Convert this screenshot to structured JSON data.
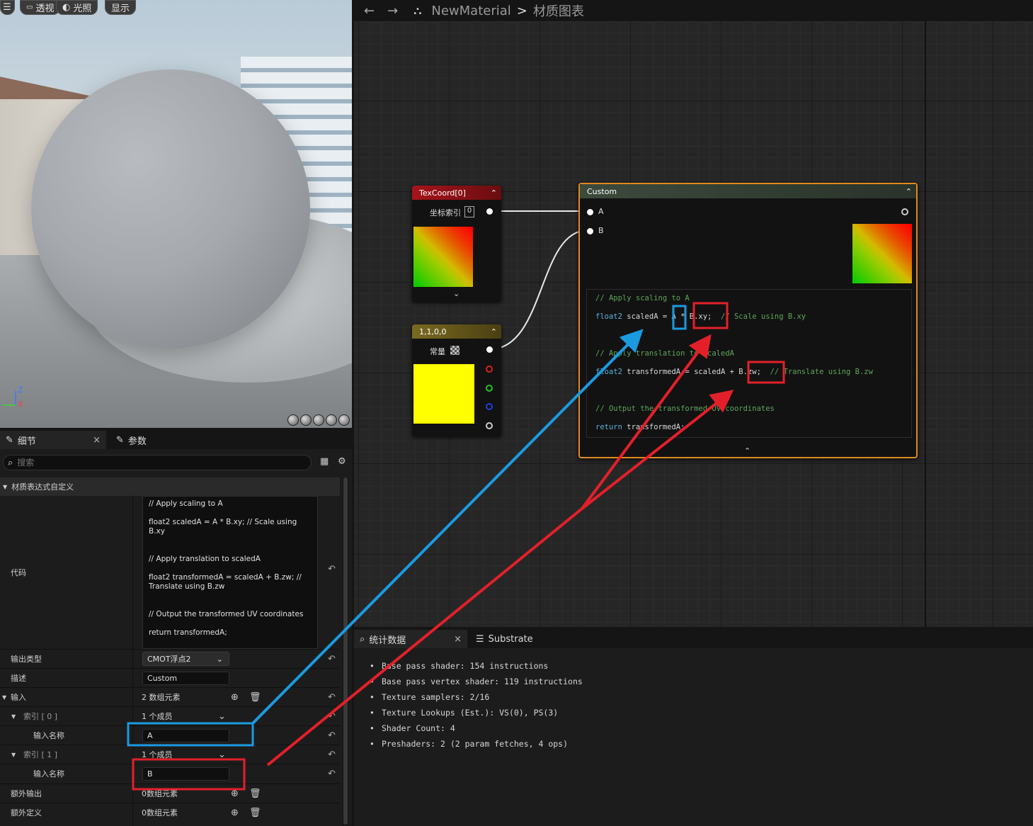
{
  "viewport": {
    "buttons": [
      {
        "label": ""
      },
      {
        "label": "透视"
      },
      {
        "label": "光照"
      },
      {
        "label": "显示"
      }
    ],
    "axis": {
      "z": "Z",
      "x": "X"
    }
  },
  "graph": {
    "breadcrumb": {
      "material": "NewMaterial",
      "separator": ">",
      "graph": "材质图表"
    },
    "texcoord": {
      "title": "TexCoord[0]",
      "index_label": "坐标索引",
      "index_value": "0"
    },
    "constant": {
      "title": "1,1,0,0",
      "label": "常量",
      "color": "#ffff00"
    },
    "custom": {
      "title": "Custom",
      "input_a": "A",
      "input_b": "B",
      "code": [
        {
          "text": "// Apply scaling to A",
          "kind": "comment"
        },
        {
          "text": "float2 scaledA = A * B.xy;  // Scale using B.xy",
          "kind": "code"
        },
        {
          "text": "// Apply translation to scaledA",
          "kind": "comment"
        },
        {
          "text": "float2 transformedA = scaledA + B.zw;  // Translate using B.zw",
          "kind": "code"
        },
        {
          "text": "// Output the transformed UV coordinates",
          "kind": "comment"
        },
        {
          "text": "return transformedA;",
          "kind": "code"
        }
      ]
    }
  },
  "details": {
    "tabs": [
      {
        "label": "细节"
      },
      {
        "label": "参数"
      }
    ],
    "search_placeholder": "搜索",
    "section": "材质表达式自定义",
    "code_label": "代码",
    "code_lines": [
      "// Apply scaling to A",
      "",
      "float2 scaledA = A * B.xy;  // Scale using B.xy",
      "",
      "",
      "// Apply translation to scaledA",
      "",
      "float2 transformedA = scaledA + B.zw;  //",
      "Translate using B.zw",
      "",
      "",
      "// Output the transformed UV coordinates",
      "",
      "return transformedA;"
    ],
    "output_type_label": "输出类型",
    "output_type_value": "CMOT浮点2",
    "description_label": "描述",
    "description_value": "Custom",
    "inputs_label": "输入",
    "inputs_value": "2 数组元素",
    "index0_label": "索引 [ 0 ]",
    "index0_value": "1 个成员",
    "input_name_label": "输入名称",
    "input_name_a": "A",
    "index1_label": "索引 [ 1 ]",
    "index1_value": "1 个成员",
    "input_name_b": "B",
    "extra_outputs_label": "额外输出",
    "extra_outputs_value": "0数组元素",
    "extra_defines_label": "额外定义",
    "extra_defines_value": "0数组元素"
  },
  "stats": {
    "tabs": [
      {
        "label": "统计数据"
      },
      {
        "label": "Substrate"
      }
    ],
    "lines": [
      "Base pass shader: 154 instructions",
      "Base pass vertex shader: 119 instructions",
      "Texture samplers: 2/16",
      "Texture Lookups (Est.): VS(0), PS(3)",
      "Shader Count: 4",
      "Preshaders: 2  (2 param fetches, 4 ops)"
    ]
  },
  "colors": {
    "highlight_blue": "#1a9be0",
    "highlight_red": "#e3202a",
    "custom_border": "#e08a1c"
  }
}
